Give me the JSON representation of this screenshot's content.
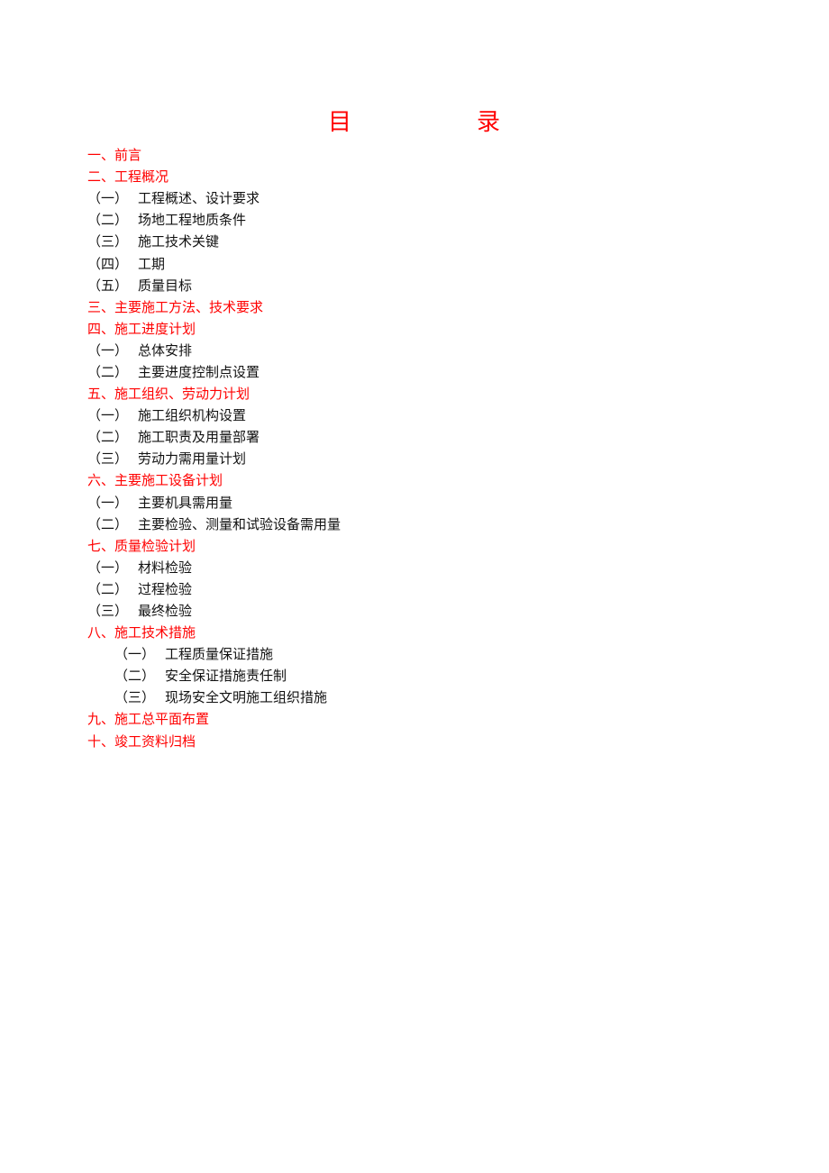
{
  "document": {
    "title_chars": [
      "目",
      "录"
    ],
    "accent_color": "#ff0000",
    "toc": [
      {
        "level": 1,
        "text": "一、前言"
      },
      {
        "level": 1,
        "text": "二、工程概况"
      },
      {
        "level": 2,
        "num": "（一）",
        "text": "工程概述、设计要求"
      },
      {
        "level": 2,
        "num": "（二）",
        "text": "场地工程地质条件"
      },
      {
        "level": 2,
        "num": "（三）",
        "text": "施工技术关键"
      },
      {
        "level": 2,
        "num": "（四）",
        "text": "工期"
      },
      {
        "level": 2,
        "num": "（五）",
        "text": "质量目标"
      },
      {
        "level": 1,
        "text": "三、主要施工方法、技术要求"
      },
      {
        "level": 1,
        "text": "四、施工进度计划"
      },
      {
        "level": 2,
        "num": "（一）",
        "text": "总体安排"
      },
      {
        "level": 2,
        "num": "（二）",
        "text": "主要进度控制点设置"
      },
      {
        "level": 1,
        "text": "五、施工组织、劳动力计划"
      },
      {
        "level": 2,
        "num": "（一）",
        "text": "施工组织机构设置"
      },
      {
        "level": 2,
        "num": "（二）",
        "text": "施工职责及用量部署"
      },
      {
        "level": 2,
        "num": "（三）",
        "text": "劳动力需用量计划"
      },
      {
        "level": 1,
        "text": "六、主要施工设备计划"
      },
      {
        "level": 2,
        "num": "（一）",
        "text": "主要机具需用量"
      },
      {
        "level": 2,
        "num": "（二）",
        "text": "主要检验、测量和试验设备需用量"
      },
      {
        "level": 1,
        "text": "七、质量检验计划"
      },
      {
        "level": 2,
        "num": "（一）",
        "text": "材料检验"
      },
      {
        "level": 2,
        "num": "（二）",
        "text": "过程检验"
      },
      {
        "level": 2,
        "num": "（三）",
        "text": "最终检验"
      },
      {
        "level": 1,
        "text": "八、施工技术措施"
      },
      {
        "level": 2,
        "indent": true,
        "num": "（一）",
        "text": "工程质量保证措施"
      },
      {
        "level": 2,
        "indent": true,
        "num": "（二）",
        "text": "安全保证措施责任制"
      },
      {
        "level": 2,
        "indent": true,
        "num": "（三）",
        "text": "现场安全文明施工组织措施"
      },
      {
        "level": 1,
        "text": "九、施工总平面布置"
      },
      {
        "level": 1,
        "text": "十、竣工资料归档"
      }
    ]
  }
}
